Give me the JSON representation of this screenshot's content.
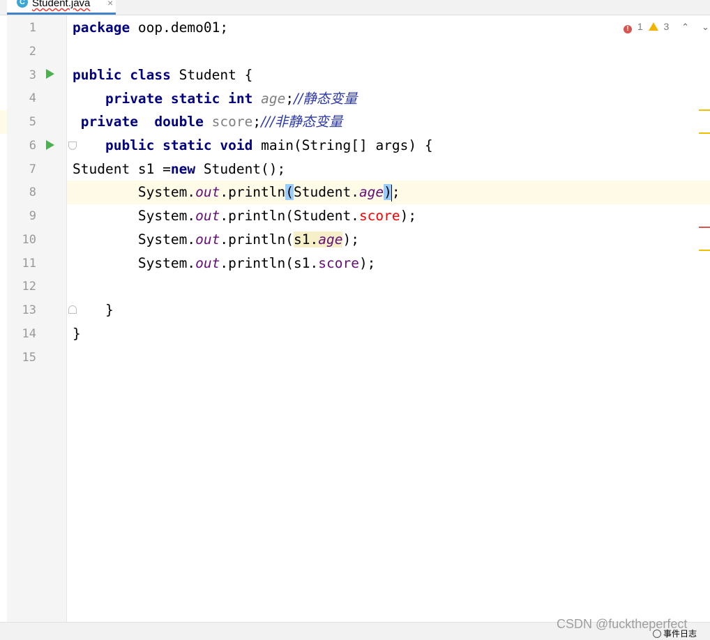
{
  "tab": {
    "icon_letter": "C",
    "label": "Student.java",
    "close": "×"
  },
  "gutter": {
    "line_numbers": [
      "1",
      "2",
      "3",
      "4",
      "5",
      "6",
      "7",
      "8",
      "9",
      "10",
      "11",
      "12",
      "13",
      "14",
      "15"
    ]
  },
  "code": {
    "line1": {
      "kw": "package",
      "rest": " oop.demo01;"
    },
    "line3": {
      "kw1": "public",
      "kw2": "class",
      "rest": " Student {"
    },
    "line4": {
      "indent": "    ",
      "kw1": "private",
      "kw2": "static",
      "kw3": "int",
      "field": "age",
      "semi": ";",
      "comment": "//静态变量"
    },
    "line5": {
      "indent": " ",
      "kw1": "private",
      "gap": "  ",
      "kw2": "double",
      "field": "score",
      "semi": ";",
      "comment": "///非静态变量"
    },
    "line6": {
      "indent": "    ",
      "kw1": "public",
      "kw2": "static",
      "kw3": "void",
      "rest": " main(String[] args) {"
    },
    "line7": {
      "pre": "Student s1 =",
      "kw": "new",
      "post": " Student();"
    },
    "line8": {
      "indent": "        ",
      "pre": "System.",
      "out": "out",
      "mid": ".println",
      "open": "(",
      "cls": "Student.",
      "field": "age",
      "close": ")",
      "end": ";"
    },
    "line9": {
      "indent": "        ",
      "pre": "System.",
      "out": "out",
      "mid": ".println(Student.",
      "field": "score",
      "end": ");"
    },
    "line10": {
      "indent": "        ",
      "pre": "System.",
      "out": "out",
      "mid": ".println(",
      "obj": "s1.",
      "field": "age",
      "end": ");"
    },
    "line11": {
      "indent": "        ",
      "pre": "System.",
      "out": "out",
      "mid": ".println(s1.",
      "field": "score",
      "end": ");"
    },
    "line13": {
      "text": "    }"
    },
    "line14": {
      "text": "}"
    }
  },
  "inspections": {
    "errors": "1",
    "warnings": "3",
    "error_glyph": "!",
    "up": "⌃",
    "down": "⌄"
  },
  "status": {
    "watermark": "CSDN @fucktheperfect",
    "event_log": "事件日志"
  },
  "colors": {
    "keyword": "#000080",
    "static_field": "#660e7a",
    "error": "#ff0000",
    "comment": "#2c39a8",
    "current_line": "#fffbe6"
  }
}
